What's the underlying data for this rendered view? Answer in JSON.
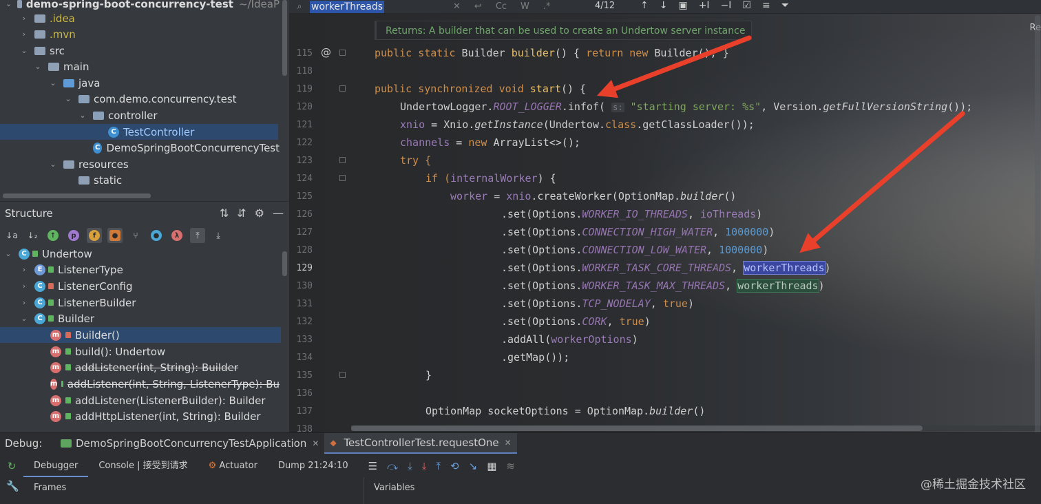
{
  "project": {
    "root": "demo-spring-boot-concurrency-test",
    "root_path": "~/IdeaP",
    "items": [
      ".idea",
      ".mvn",
      "src",
      "main",
      "java",
      "com.demo.concurrency.test",
      "controller",
      "TestController",
      "DemoSpringBootConcurrencyTest",
      "resources",
      "static"
    ]
  },
  "structure": {
    "title": "Structure",
    "items": [
      {
        "label": "Undertow"
      },
      {
        "label": "ListenerType"
      },
      {
        "label": "ListenerConfig"
      },
      {
        "label": "ListenerBuilder"
      },
      {
        "label": "Builder"
      },
      {
        "label": "Builder()"
      },
      {
        "label": "build(): Undertow"
      },
      {
        "label": "addListener(int, String): Builder"
      },
      {
        "label": "addListener(int, String, ListenerType): Bu"
      },
      {
        "label": "addListener(ListenerBuilder): Builder"
      },
      {
        "label": "addHttpListener(int, String): Builder"
      }
    ]
  },
  "search": {
    "query": "workerThreads",
    "match_count": "4/12"
  },
  "editor": {
    "doc_hint": "Returns: A builder that can be used to create an Undertow server instance",
    "right_label": "Re",
    "line_numbers": [
      "115",
      "118",
      "119",
      "120",
      "121",
      "122",
      "123",
      "124",
      "125",
      "126",
      "127",
      "128",
      "129",
      "130",
      "131",
      "132",
      "133",
      "134",
      "135",
      "136",
      "137",
      "138"
    ],
    "current_line": "129",
    "code": {
      "l115_a": "public static ",
      "l115_b": "Builder ",
      "l115_c": "builder",
      "l115_d": "() { ",
      "l115_e": "return new ",
      "l115_f": "Builder(); }",
      "l119_a": "public synchronized void ",
      "l119_b": "start",
      "l119_c": "() {",
      "l120_a": "UndertowLogger.",
      "l120_b": "ROOT_LOGGER",
      "l120_c": ".infof( ",
      "l120_hint": "s:",
      "l120_d": " \"starting server: %s\"",
      "l120_e": ", Version.",
      "l120_f": "getFullVersionString",
      "l120_g": "());",
      "l121_a": "xnio",
      "l121_b": " = Xnio.",
      "l121_c": "getInstance",
      "l121_d": "(Undertow.",
      "l121_e": "class",
      "l121_f": ".getClassLoader());",
      "l122_a": "channels",
      "l122_b": " = ",
      "l122_c": "new ",
      "l122_d": "ArrayList<>();",
      "l123": "try {",
      "l124_a": "if (",
      "l124_b": "internalWorker",
      "l124_c": ") {",
      "l125_a": "worker",
      "l125_b": " = ",
      "l125_c": "xnio",
      "l125_d": ".createWorker(OptionMap.",
      "l125_e": "builder",
      "l125_f": "()",
      "l126_a": ".set(Options.",
      "l126_b": "WORKER_IO_THREADS",
      "l126_c": ", ",
      "l126_d": "ioThreads",
      "l126_e": ")",
      "l127_a": ".set(Options.",
      "l127_b": "CONNECTION_HIGH_WATER",
      "l127_c": ", ",
      "l127_d": "1000000",
      "l127_e": ")",
      "l128_a": ".set(Options.",
      "l128_b": "CONNECTION_LOW_WATER",
      "l128_c": ", ",
      "l128_d": "1000000",
      "l128_e": ")",
      "l129_a": ".set(Options.",
      "l129_b": "WORKER_TASK_CORE_THREADS",
      "l129_c": ", ",
      "l129_d": "workerThreads",
      "l129_e": ")",
      "l130_a": ".set(Options.",
      "l130_b": "WORKER_TASK_MAX_THREADS",
      "l130_c": ", ",
      "l130_d": "workerThreads",
      "l130_e": ")",
      "l131_a": ".set(Options.",
      "l131_b": "TCP_NODELAY",
      "l131_c": ", ",
      "l131_d": "true",
      "l131_e": ")",
      "l132_a": ".set(Options.",
      "l132_b": "CORK",
      "l132_c": ", ",
      "l132_d": "true",
      "l132_e": ")",
      "l133_a": ".addAll(",
      "l133_b": "workerOptions",
      "l133_c": ")",
      "l134": ".getMap());",
      "l135": "}",
      "l137_a": "OptionMap socketOptions = OptionMap.",
      "l137_b": "builder",
      "l137_c": "()"
    }
  },
  "debug": {
    "label": "Debug:",
    "tabs": [
      "DemoSpringBootConcurrencyTestApplication",
      "TestControllerTest.requestOne"
    ],
    "subtabs": [
      "Debugger",
      "Console | 接受到请求",
      "Actuator",
      "Dump 21:24:10"
    ],
    "frames_label": "Frames",
    "variables_label": "Variables"
  },
  "watermark": "@稀土掘金技术社区",
  "colors": {
    "accent_arrow": "#e8402a",
    "search_match": "#3a46a0",
    "keyword": "#cf8e4a",
    "constant": "#9574b0"
  }
}
